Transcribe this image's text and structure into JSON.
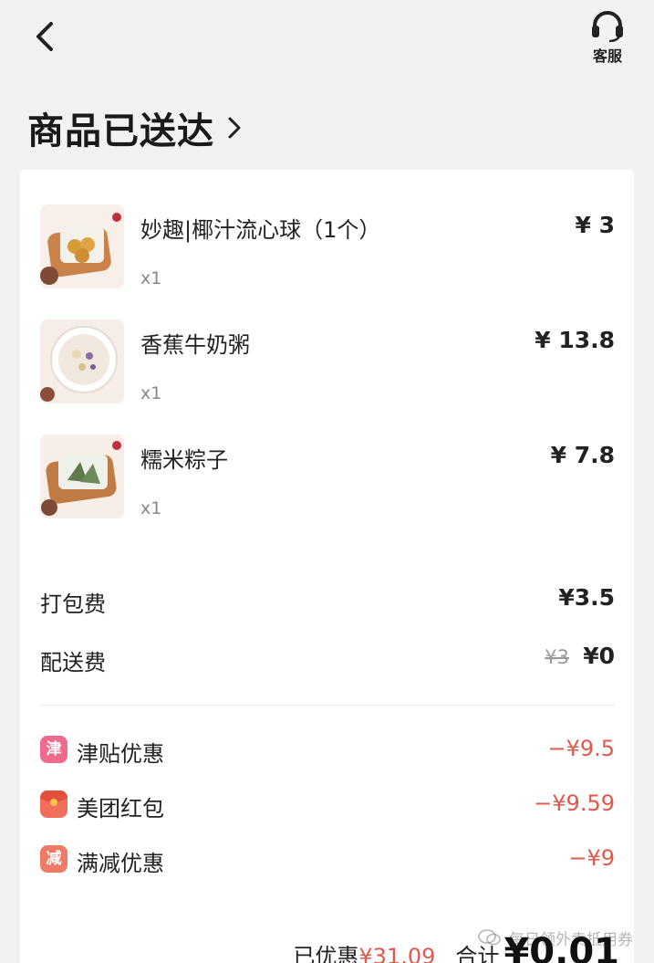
{
  "header": {
    "service_label": "客服",
    "page_title": "商品已送达"
  },
  "items": [
    {
      "name": "妙趣|椰汁流心球（1个）",
      "qty": "x1",
      "price": "¥ 3"
    },
    {
      "name": "香蕉牛奶粥",
      "qty": "x1",
      "price": "¥ 13.8"
    },
    {
      "name": "糯米粽子",
      "qty": "x1",
      "price": "¥ 7.8"
    }
  ],
  "fees": {
    "packing_label": "打包费",
    "packing_value": "¥3.5",
    "delivery_label": "配送费",
    "delivery_original": "¥3",
    "delivery_value": "¥0"
  },
  "discounts": [
    {
      "icon_char": "津",
      "label": "津贴优惠",
      "value": "−¥9.5",
      "color": "#f06a8e"
    },
    {
      "icon_char": "",
      "icon": "red-packet-icon",
      "label": "美团红包",
      "value": "−¥9.59",
      "color": "#f26d5a"
    },
    {
      "icon_char": "减",
      "label": "满减优惠",
      "value": "−¥9",
      "color": "#ef7a66"
    }
  ],
  "summary": {
    "saved_label": "已优惠",
    "saved_value": "¥31.09",
    "total_label": "合计",
    "total_value": "¥0.01"
  },
  "watermark": "每日领外卖抵用券",
  "colors": {
    "accent_red": "#e05a4c"
  }
}
